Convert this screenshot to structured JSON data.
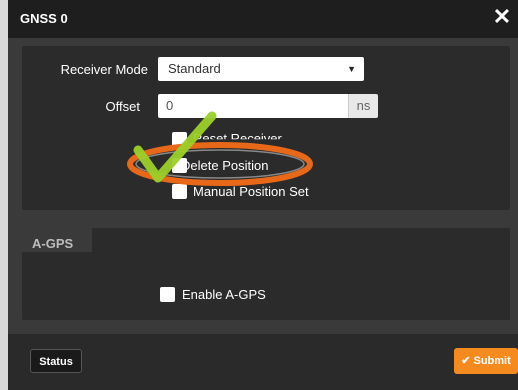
{
  "dialog": {
    "title": "GNSS 0"
  },
  "receiver_mode": {
    "label": "Receiver Mode",
    "value": "Standard"
  },
  "offset": {
    "label": "Offset",
    "value": "0",
    "unit": "ns"
  },
  "options": [
    {
      "label": "Reset Receiver"
    },
    {
      "label": "Delete Position"
    },
    {
      "label": "Manual Position Set"
    }
  ],
  "agps": {
    "title": "A-GPS",
    "enable_label": "Enable A-GPS"
  },
  "footer": {
    "status_label": "Status",
    "submit_label": "Submit"
  },
  "colors": {
    "accent": "#f58b1f",
    "highlight": "#e8681a",
    "check": "#9bd028"
  }
}
